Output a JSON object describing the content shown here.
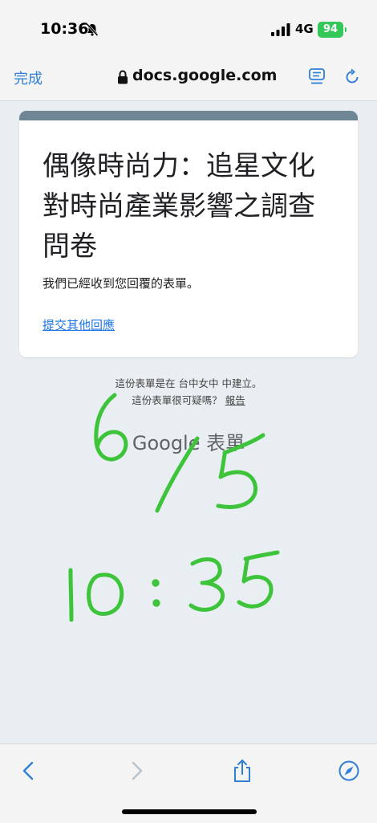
{
  "status_bar": {
    "time": "10:36",
    "network": "4G",
    "battery": "94"
  },
  "browser": {
    "done_label": "完成",
    "url": "docs.google.com"
  },
  "form": {
    "title": "偶像時尚力：追星文化對時尚產業影響之調查問卷",
    "confirmation": "我們已經收到您回覆的表單。",
    "resubmit_link": "提交其他回應"
  },
  "footer": {
    "created_in": "這份表單是在 台中女中 中建立。",
    "suspicious": "這份表單很可疑嗎？",
    "report": "報告",
    "logo": "Google 表單"
  },
  "handwriting": {
    "date": "6/5",
    "time": "10:35",
    "ink_color": "#3ec43b"
  },
  "icons": {
    "muted": "bell-slash-icon",
    "back": "chevron-left-icon",
    "forward": "chevron-right-icon",
    "share": "share-icon",
    "bookmarks": "compass-icon"
  }
}
